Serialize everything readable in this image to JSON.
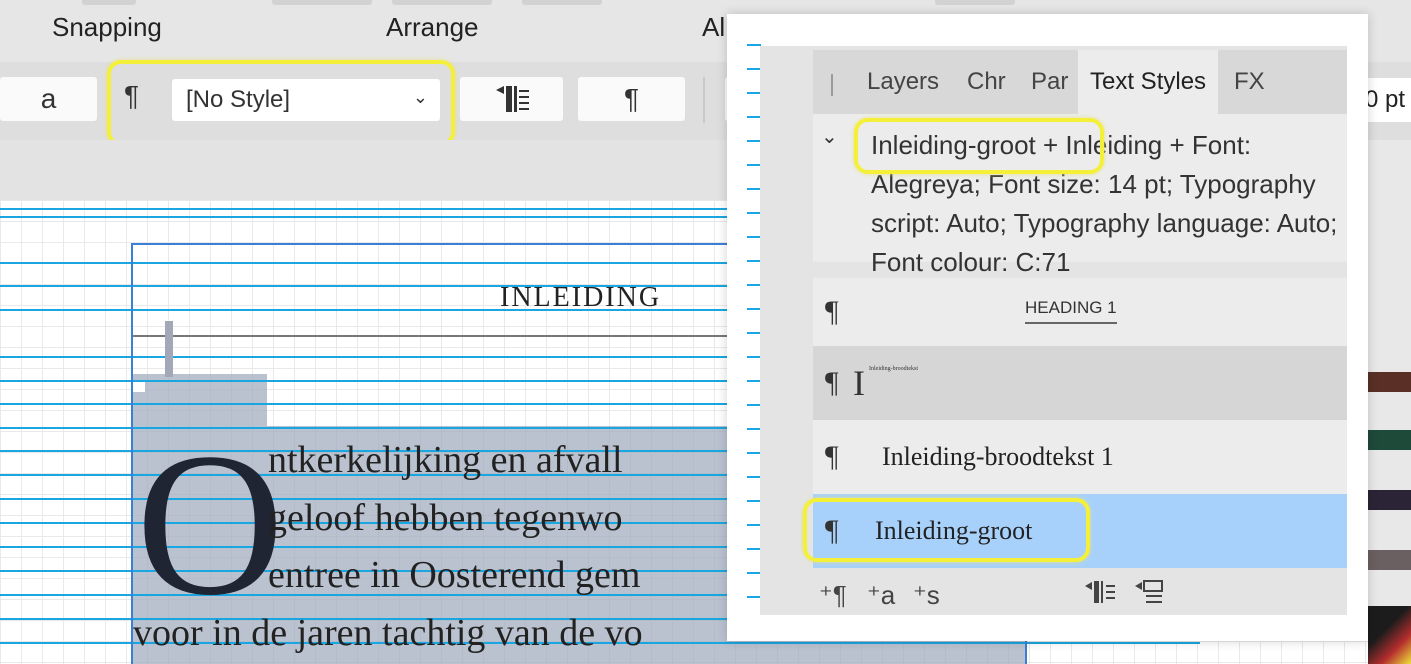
{
  "topbar": {
    "labels": [
      "Snapping",
      "Arrange",
      "Al"
    ]
  },
  "toolbar": {
    "char_button": "a",
    "pilcrow_label": "¶",
    "style_select_value": "[No Style]",
    "style_select_chevron": "⌄",
    "para_style_button": "¶",
    "pt_value": "0 pt"
  },
  "page": {
    "heading": "INLEIDING",
    "drop_cap": "O",
    "body_lines": [
      "ntkerkelijking  en  afvall",
      "geloof  hebben  tegenwo",
      "entree in Oosterend gem",
      "voor in de jaren tachtig van de vo"
    ]
  },
  "text_styles_panel": {
    "tabs": [
      "Layers",
      "Chr",
      "Par",
      "Text Styles",
      "FX"
    ],
    "active_tab": "Text Styles",
    "description": "Inleiding-groot + Inleiding + Font: Alegreya; Font size: 14 pt; Typography script: Auto; Typography language: Auto; Font colour: C:71",
    "styles": [
      {
        "icon": "¶",
        "name": "HEADING 1"
      },
      {
        "icon": "¶",
        "name": "I",
        "tiny": "Inleiding-broodtekst"
      },
      {
        "icon": "¶",
        "name": "Inleiding-broodtekst 1"
      },
      {
        "icon": "¶",
        "name": "Inleiding-groot"
      }
    ],
    "bottom_icons": [
      "⁺¶",
      "⁺a",
      "⁺s"
    ]
  },
  "colors": {
    "highlight": "#f4f03a",
    "selected_row": "#a7d1fb",
    "baseline": "#1aa6e0",
    "frame": "#3b7fd6"
  }
}
